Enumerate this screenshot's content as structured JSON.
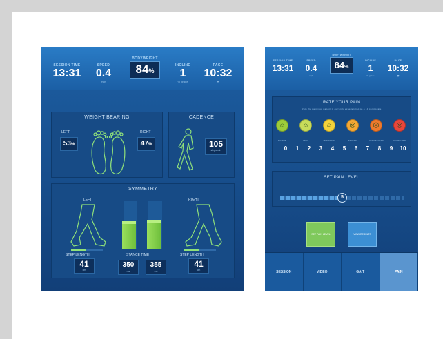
{
  "screen_a": {
    "header": {
      "session_time": {
        "label": "SESSION TIME",
        "value": "13:31"
      },
      "speed": {
        "label": "SPEED",
        "value": "0.4",
        "unit": "mph"
      },
      "bodyweight": {
        "label": "BODYWEIGHT",
        "value": "84",
        "unit": "%"
      },
      "incline": {
        "label": "INCLINE",
        "value": "1",
        "unit": "% grade"
      },
      "pace": {
        "label": "PACE",
        "value": "10:32"
      }
    },
    "weight_bearing": {
      "title": "WEIGHT BEARING",
      "left_label": "LEFT",
      "left_value": "53",
      "left_unit": "%",
      "right_label": "RIGHT",
      "right_value": "47",
      "right_unit": "%"
    },
    "cadence": {
      "title": "CADENCE",
      "value": "105",
      "unit": "steps/min"
    },
    "symmetry": {
      "title": "SYMMETRY",
      "left_label": "LEFT",
      "right_label": "RIGHT",
      "left_step_label": "STEP LENGTH",
      "left_step_value": "41",
      "left_step_unit": "cm",
      "right_step_label": "STEP LENGTH",
      "right_step_value": "41",
      "right_step_unit": "cm",
      "stance_label": "STANCE TIME",
      "stance_left": "350",
      "stance_left_unit": "ms",
      "stance_right": "355",
      "stance_right_unit": "ms",
      "left_bar_fill": 0.45,
      "right_bar_fill": 0.45
    }
  },
  "screen_b": {
    "header": {
      "session_time": {
        "label": "SESSION TIME",
        "value": "13:31"
      },
      "speed": {
        "label": "SPEED",
        "value": "0.4",
        "unit": "mph"
      },
      "bodyweight": {
        "label": "BODYWEIGHT",
        "value": "84",
        "unit": "%"
      },
      "incline": {
        "label": "INCLINE",
        "value": "1",
        "unit": "% grade"
      },
      "pace": {
        "label": "PACE",
        "value": "10:32"
      }
    },
    "pain": {
      "title": "RATE YOUR PAIN",
      "subtitle": "Rate the pain your patient is currently experiencing on a 10 point scale",
      "face_labels": [
        "NO PAIN",
        "MILD",
        "MODERATE",
        "SEVERE",
        "VERY SEVERE",
        "WORST PAIN"
      ],
      "numbers": [
        "0",
        "1",
        "2",
        "3",
        "4",
        "5",
        "6",
        "7",
        "8",
        "9",
        "10"
      ],
      "face_colors": [
        "#9ccc3a",
        "#c8dc5a",
        "#f4d23a",
        "#f5a834",
        "#f07a2c",
        "#e8453a"
      ]
    },
    "set_pain": {
      "title": "SET PAIN LEVEL",
      "value": "5",
      "max": 10
    },
    "buttons": {
      "set_pain": "SET PAIN LEVEL",
      "view_results": "VIEW RESULTS"
    },
    "tabs": [
      "SESSION",
      "VIDEO",
      "GAIT",
      "PAIN"
    ],
    "active_tab": "PAIN"
  }
}
